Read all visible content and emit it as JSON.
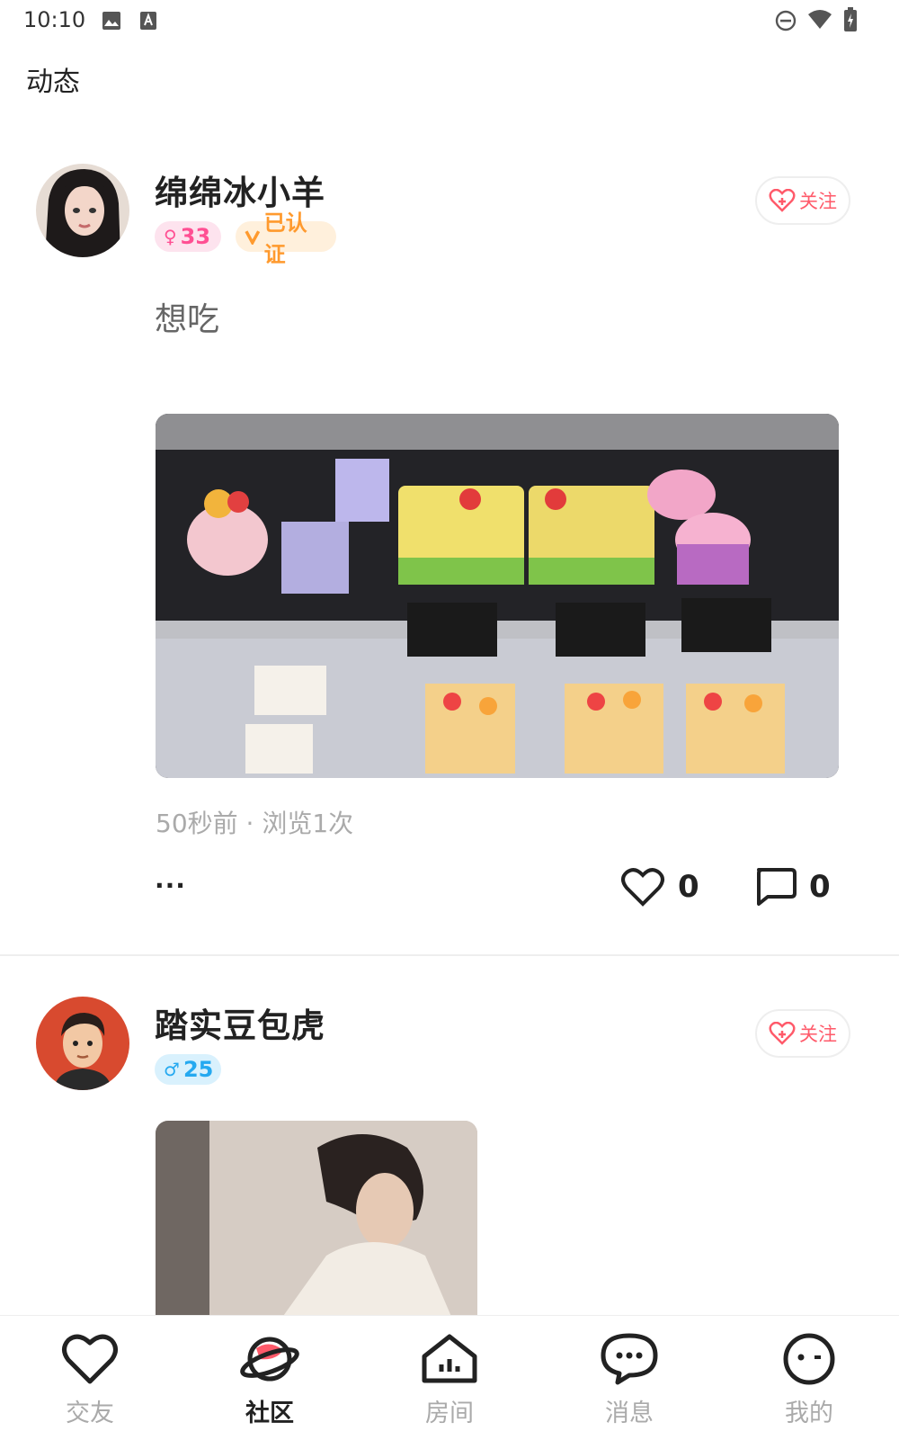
{
  "status_bar": {
    "time": "10:10"
  },
  "page_title": "动态",
  "posts": [
    {
      "username": "绵绵冰小羊",
      "gender_symbol": "♀",
      "age": "33",
      "verified_label": "已认证",
      "follow_label": "关注",
      "text": "想吃",
      "meta": "50秒前 · 浏览1次",
      "more_label": "···",
      "likes": "0",
      "comments": "0"
    },
    {
      "username": "踏实豆包虎",
      "gender_symbol": "♂",
      "age": "25",
      "follow_label": "关注"
    }
  ],
  "tabs": [
    {
      "label": "交友",
      "icon": "heart-icon"
    },
    {
      "label": "社区",
      "icon": "planet-icon"
    },
    {
      "label": "房间",
      "icon": "house-icon"
    },
    {
      "label": "消息",
      "icon": "chat-icon"
    },
    {
      "label": "我的",
      "icon": "face-icon"
    }
  ],
  "colors": {
    "accent": "#ff5a6a",
    "female": "#ff4f93",
    "male": "#25a9f0",
    "verified": "#ff9a2e"
  }
}
